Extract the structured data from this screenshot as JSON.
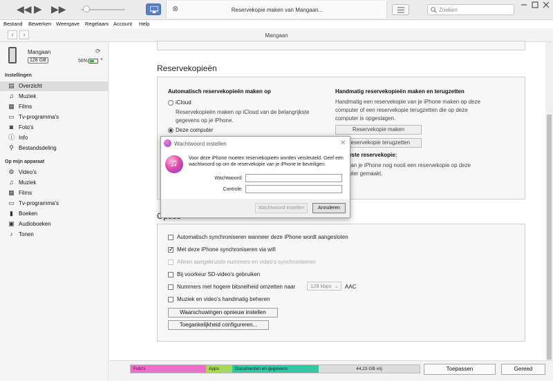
{
  "window": {
    "now_playing_title": "Reservekopie maken van Mangaan...",
    "search_placeholder": "Zoeken",
    "colors": {
      "accent": "#5a7fc4",
      "selection": "#dcdcdc"
    }
  },
  "menubar": {
    "items": [
      "Bestand",
      "Bewerken",
      "Weergave",
      "Regelaars",
      "Account",
      "Help"
    ]
  },
  "nav": {
    "title": "Mangaan"
  },
  "device": {
    "name": "Mangaan",
    "capacity": "128 GB",
    "battery": "56%",
    "battery_level": 0.56
  },
  "sidebar": {
    "settings_header": "Instellingen",
    "settings_items": [
      {
        "label": "Overzicht",
        "icon": "summary-icon",
        "selected": true
      },
      {
        "label": "Muziek",
        "icon": "music-note-icon"
      },
      {
        "label": "Films",
        "icon": "film-icon"
      },
      {
        "label": "Tv-programma's",
        "icon": "tv-icon"
      },
      {
        "label": "Foto's",
        "icon": "camera-icon"
      },
      {
        "label": "Info",
        "icon": "info-icon"
      },
      {
        "label": "Bestandsdeling",
        "icon": "file-sharing-icon"
      }
    ],
    "device_header": "Op mijn apparaat",
    "device_items": [
      {
        "label": "Video's",
        "icon": "gear-video-icon"
      },
      {
        "label": "Muziek",
        "icon": "music-note-icon"
      },
      {
        "label": "Films",
        "icon": "film-icon"
      },
      {
        "label": "Tv-programma's",
        "icon": "tv-icon"
      },
      {
        "label": "Boeken",
        "icon": "book-icon"
      },
      {
        "label": "Audioboeken",
        "icon": "audiobook-icon"
      },
      {
        "label": "Tonen",
        "icon": "bell-icon"
      }
    ]
  },
  "backups": {
    "heading": "Reservekopieën",
    "auto_title": "Automatisch reservekopieën maken op",
    "icloud_label": "iCloud",
    "icloud_desc_1": "Reservekopieën maken op iCloud van de belangrijkste",
    "icloud_desc_2": "gegevens op je iPhone.",
    "computer_label": "Deze computer",
    "manual_title": "Handmatig reservekopieën maken en terugzetten",
    "manual_desc_1": "Handmatig een reservekopie van je iPhone maken op deze",
    "manual_desc_2": "computer of een reservekopie terugzetten die op deze",
    "manual_desc_3": "computer is opgeslagen.",
    "make_backup_button": "Reservekopie maken",
    "restore_backup_button": "Reservekopie terugzetten",
    "latest_title": "Nieuwste reservekopie:",
    "latest_desc_1": "Er is van je iPhone nog nooit een reservekopie op deze",
    "latest_desc_2": "computer gemaakt."
  },
  "options": {
    "heading": "Opties",
    "items": [
      {
        "label": "Automatisch synchroniseren wanneer deze iPhone wordt aangesloten",
        "checked": false,
        "disabled": false
      },
      {
        "label": "Met deze iPhone synchroniseren via wifi",
        "checked": true,
        "disabled": false
      },
      {
        "label": "Alleen aangekruiste nummers en video's synchroniseren",
        "checked": false,
        "disabled": true
      },
      {
        "label": "Bij voorkeur SD-video's gebruiken",
        "checked": false,
        "disabled": false
      },
      {
        "label": "Nummers met hogere bitsnelheid omzetten naar",
        "checked": false,
        "disabled": false
      },
      {
        "label": "Muziek en video's handmatig beheren",
        "checked": false,
        "disabled": false
      }
    ],
    "bitrate_value": "128 kbps",
    "format_label": "AAC",
    "reset_warnings_button": "Waarschuwingen opnieuw instellen",
    "accessibility_button": "Toegankelijkheid configureren..."
  },
  "dialog": {
    "title": "Wachtwoord instellen",
    "message": "Voor deze iPhone moeten reservekopieën worden versleuteld. Geef een wachtwoord op om de reservekopie van je iPhone te beveiligen.",
    "password_label": "Wachtwoord:",
    "confirm_label": "Controle:",
    "password_value": "",
    "confirm_value": "",
    "set_button": "Wachtwoord instellen",
    "cancel_button": "Annuleren"
  },
  "capacity_bar": {
    "segments": [
      {
        "label": "Foto's",
        "color": "#ee6fc9",
        "fraction": 0.26
      },
      {
        "label": "Apps",
        "color": "#a8d85a",
        "fraction": 0.09
      },
      {
        "label": "Documenten en gegevens",
        "color": "#35c6a2",
        "fraction": 0.3
      }
    ],
    "free_label": "44,23 GB vrij",
    "apply_button": "Toepassen",
    "done_button": "Gereed"
  }
}
